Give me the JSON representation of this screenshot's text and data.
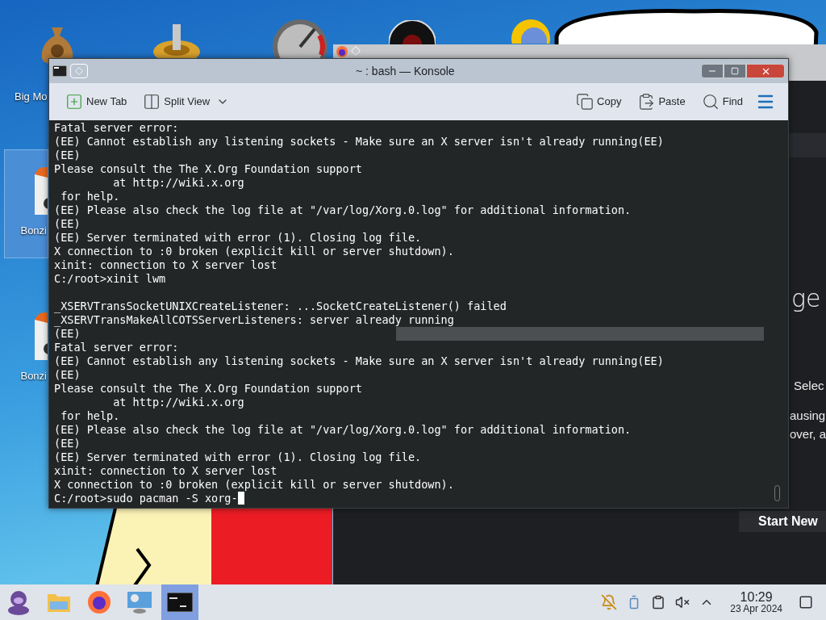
{
  "desktop": {
    "icons": [
      {
        "label": "Big Mo",
        "selected": false
      },
      {
        "label": "Bonzi",
        "selected": true
      },
      {
        "label": "Bonzi",
        "selected": false
      }
    ]
  },
  "background_window": {
    "heading": "ge",
    "lines": [
      "Selec",
      "ausing",
      "over, a"
    ],
    "button": "Start New"
  },
  "konsole": {
    "title": "~ : bash — Konsole",
    "toolbar_left": [
      {
        "kind": "new-tab",
        "label": "New Tab"
      },
      {
        "kind": "split",
        "label": "Split View"
      }
    ],
    "toolbar_right": [
      {
        "kind": "copy",
        "label": "Copy"
      },
      {
        "kind": "paste",
        "label": "Paste"
      },
      {
        "kind": "find",
        "label": "Find"
      }
    ],
    "lines": [
      {
        "kind": "text",
        "text": "Fatal server error:",
        "highlight": false
      },
      {
        "kind": "text",
        "text": "(EE) Cannot establish any listening sockets - Make sure an X server isn't already running(EE)",
        "highlight": false
      },
      {
        "kind": "text",
        "text": "(EE)",
        "highlight": false
      },
      {
        "kind": "text",
        "text": "Please consult the The X.Org Foundation support",
        "highlight": false
      },
      {
        "kind": "text",
        "text": "         at http://wiki.x.org",
        "highlight": false
      },
      {
        "kind": "text",
        "text": " for help.",
        "highlight": false
      },
      {
        "kind": "text",
        "text": "(EE) Please also check the log file at \"/var/log/Xorg.0.log\" for additional information.",
        "highlight": false
      },
      {
        "kind": "text",
        "text": "(EE)",
        "highlight": false
      },
      {
        "kind": "text",
        "text": "(EE) Server terminated with error (1). Closing log file.",
        "highlight": false
      },
      {
        "kind": "text",
        "text": "X connection to :0 broken (explicit kill or server shutdown).",
        "highlight": false
      },
      {
        "kind": "text",
        "text": "xinit: connection to X server lost",
        "highlight": false
      },
      {
        "kind": "text",
        "text": "C:/root>xinit lwm",
        "highlight": false
      },
      {
        "kind": "blank"
      },
      {
        "kind": "text",
        "text": "_XSERVTransSocketUNIXCreateListener: ...SocketCreateListener() failed",
        "highlight": false
      },
      {
        "kind": "text",
        "text": "_XSERVTransMakeAllCOTSServerListeners: server already running",
        "highlight": false
      },
      {
        "kind": "text",
        "text": "(EE)",
        "highlight": true
      },
      {
        "kind": "text",
        "text": "Fatal server error:",
        "highlight": false
      },
      {
        "kind": "text",
        "text": "(EE) Cannot establish any listening sockets - Make sure an X server isn't already running(EE)",
        "highlight": false
      },
      {
        "kind": "text",
        "text": "(EE)",
        "highlight": false
      },
      {
        "kind": "text",
        "text": "Please consult the The X.Org Foundation support",
        "highlight": false
      },
      {
        "kind": "text",
        "text": "         at http://wiki.x.org",
        "highlight": false
      },
      {
        "kind": "text",
        "text": " for help.",
        "highlight": false
      },
      {
        "kind": "text",
        "text": "(EE) Please also check the log file at \"/var/log/Xorg.0.log\" for additional information.",
        "highlight": false
      },
      {
        "kind": "text",
        "text": "(EE)",
        "highlight": false
      },
      {
        "kind": "text",
        "text": "(EE) Server terminated with error (1). Closing log file.",
        "highlight": false
      },
      {
        "kind": "text",
        "text": "xinit: connection to X server lost",
        "highlight": false
      },
      {
        "kind": "text",
        "text": "X connection to :0 broken (explicit kill or server shutdown).",
        "highlight": false
      },
      {
        "kind": "prompt",
        "text": "C:/root>sudo pacman -S xorg-",
        "highlight": false
      }
    ]
  },
  "taskbar": {
    "tasks": [
      {
        "kind": "gorilla",
        "selected": false
      },
      {
        "kind": "folder",
        "selected": false
      },
      {
        "kind": "browser",
        "selected": false
      },
      {
        "kind": "network",
        "selected": false
      },
      {
        "kind": "terminal",
        "selected": true
      }
    ],
    "time": "10:29",
    "date": "23 Apr 2024"
  }
}
